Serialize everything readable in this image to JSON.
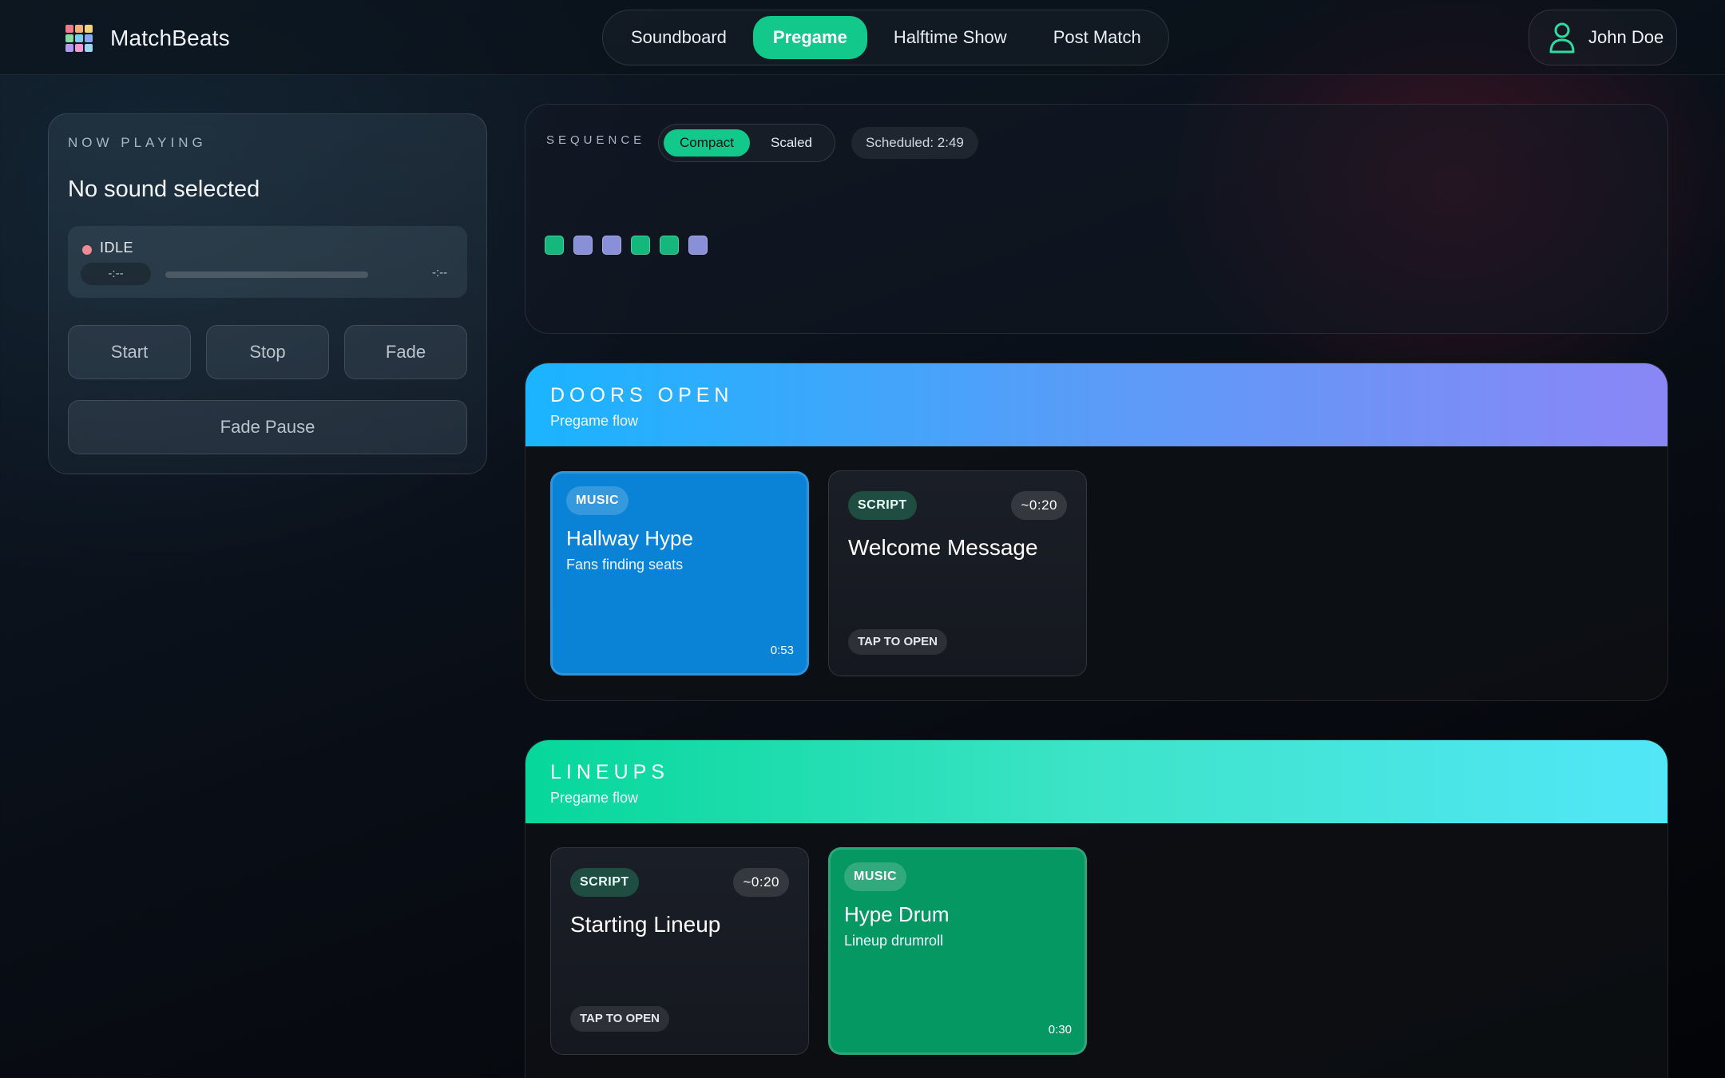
{
  "app": {
    "name": "MatchBeats",
    "logo_colors": [
      "#f07a8c",
      "#f3b07a",
      "#f0d47a",
      "#8ad9a0",
      "#7ad0e6",
      "#8aa8f0",
      "#b39af0",
      "#f09ad0",
      "#9ad7f0"
    ]
  },
  "nav": {
    "tabs": [
      {
        "label": "Soundboard",
        "active": false
      },
      {
        "label": "Pregame",
        "active": true
      },
      {
        "label": "Halftime Show",
        "active": false
      },
      {
        "label": "Post Match",
        "active": false
      }
    ],
    "active_color": "#12c98b"
  },
  "user": {
    "name": "John Doe",
    "icon": "user-icon"
  },
  "now_playing": {
    "label": "NOW PLAYING",
    "title": "No sound selected",
    "status": "IDLE",
    "status_color": "#f08a96",
    "elapsed": "-:--",
    "remaining": "-:--",
    "progress": 0,
    "buttons": {
      "start": "Start",
      "stop": "Stop",
      "fade": "Fade",
      "fade_pause": "Fade Pause"
    }
  },
  "sequence": {
    "label": "SEQUENCE",
    "modes": [
      {
        "label": "Compact",
        "active": true
      },
      {
        "label": "Scaled",
        "active": false
      }
    ],
    "scheduled": "Scheduled: 2:49",
    "blocks": [
      {
        "kind": "music",
        "color": "#14b87c"
      },
      {
        "kind": "script",
        "color": "#8a90d8"
      },
      {
        "kind": "script",
        "color": "#8a90d8"
      },
      {
        "kind": "music",
        "color": "#14b87c"
      },
      {
        "kind": "music",
        "color": "#14b87c"
      },
      {
        "kind": "script",
        "color": "#8a90d8"
      }
    ]
  },
  "sections": [
    {
      "title": "DOORS OPEN",
      "subtitle": "Pregame flow",
      "gradient": [
        "#1ab4ff",
        "#5a9cf8",
        "#8a86f6"
      ],
      "cards": [
        {
          "type": "music",
          "badge": "MUSIC",
          "title": "Hallway Hype",
          "subtitle": "Fans finding seats",
          "time": "0:53",
          "color": "#0a82d6"
        },
        {
          "type": "script",
          "badge": "SCRIPT",
          "duration": "~0:20",
          "title": "Welcome Message",
          "action": "TAP TO OPEN"
        }
      ]
    },
    {
      "title": "LINEUPS",
      "subtitle": "Pregame flow",
      "gradient": [
        "#06d79a",
        "#3de4c8",
        "#52e6f8"
      ],
      "cards": [
        {
          "type": "script",
          "badge": "SCRIPT",
          "duration": "~0:20",
          "title": "Starting Lineup",
          "action": "TAP TO OPEN"
        },
        {
          "type": "music",
          "badge": "MUSIC",
          "title": "Hype Drum",
          "subtitle": "Lineup drumroll",
          "time": "0:30",
          "color": "#069862"
        }
      ]
    }
  ]
}
